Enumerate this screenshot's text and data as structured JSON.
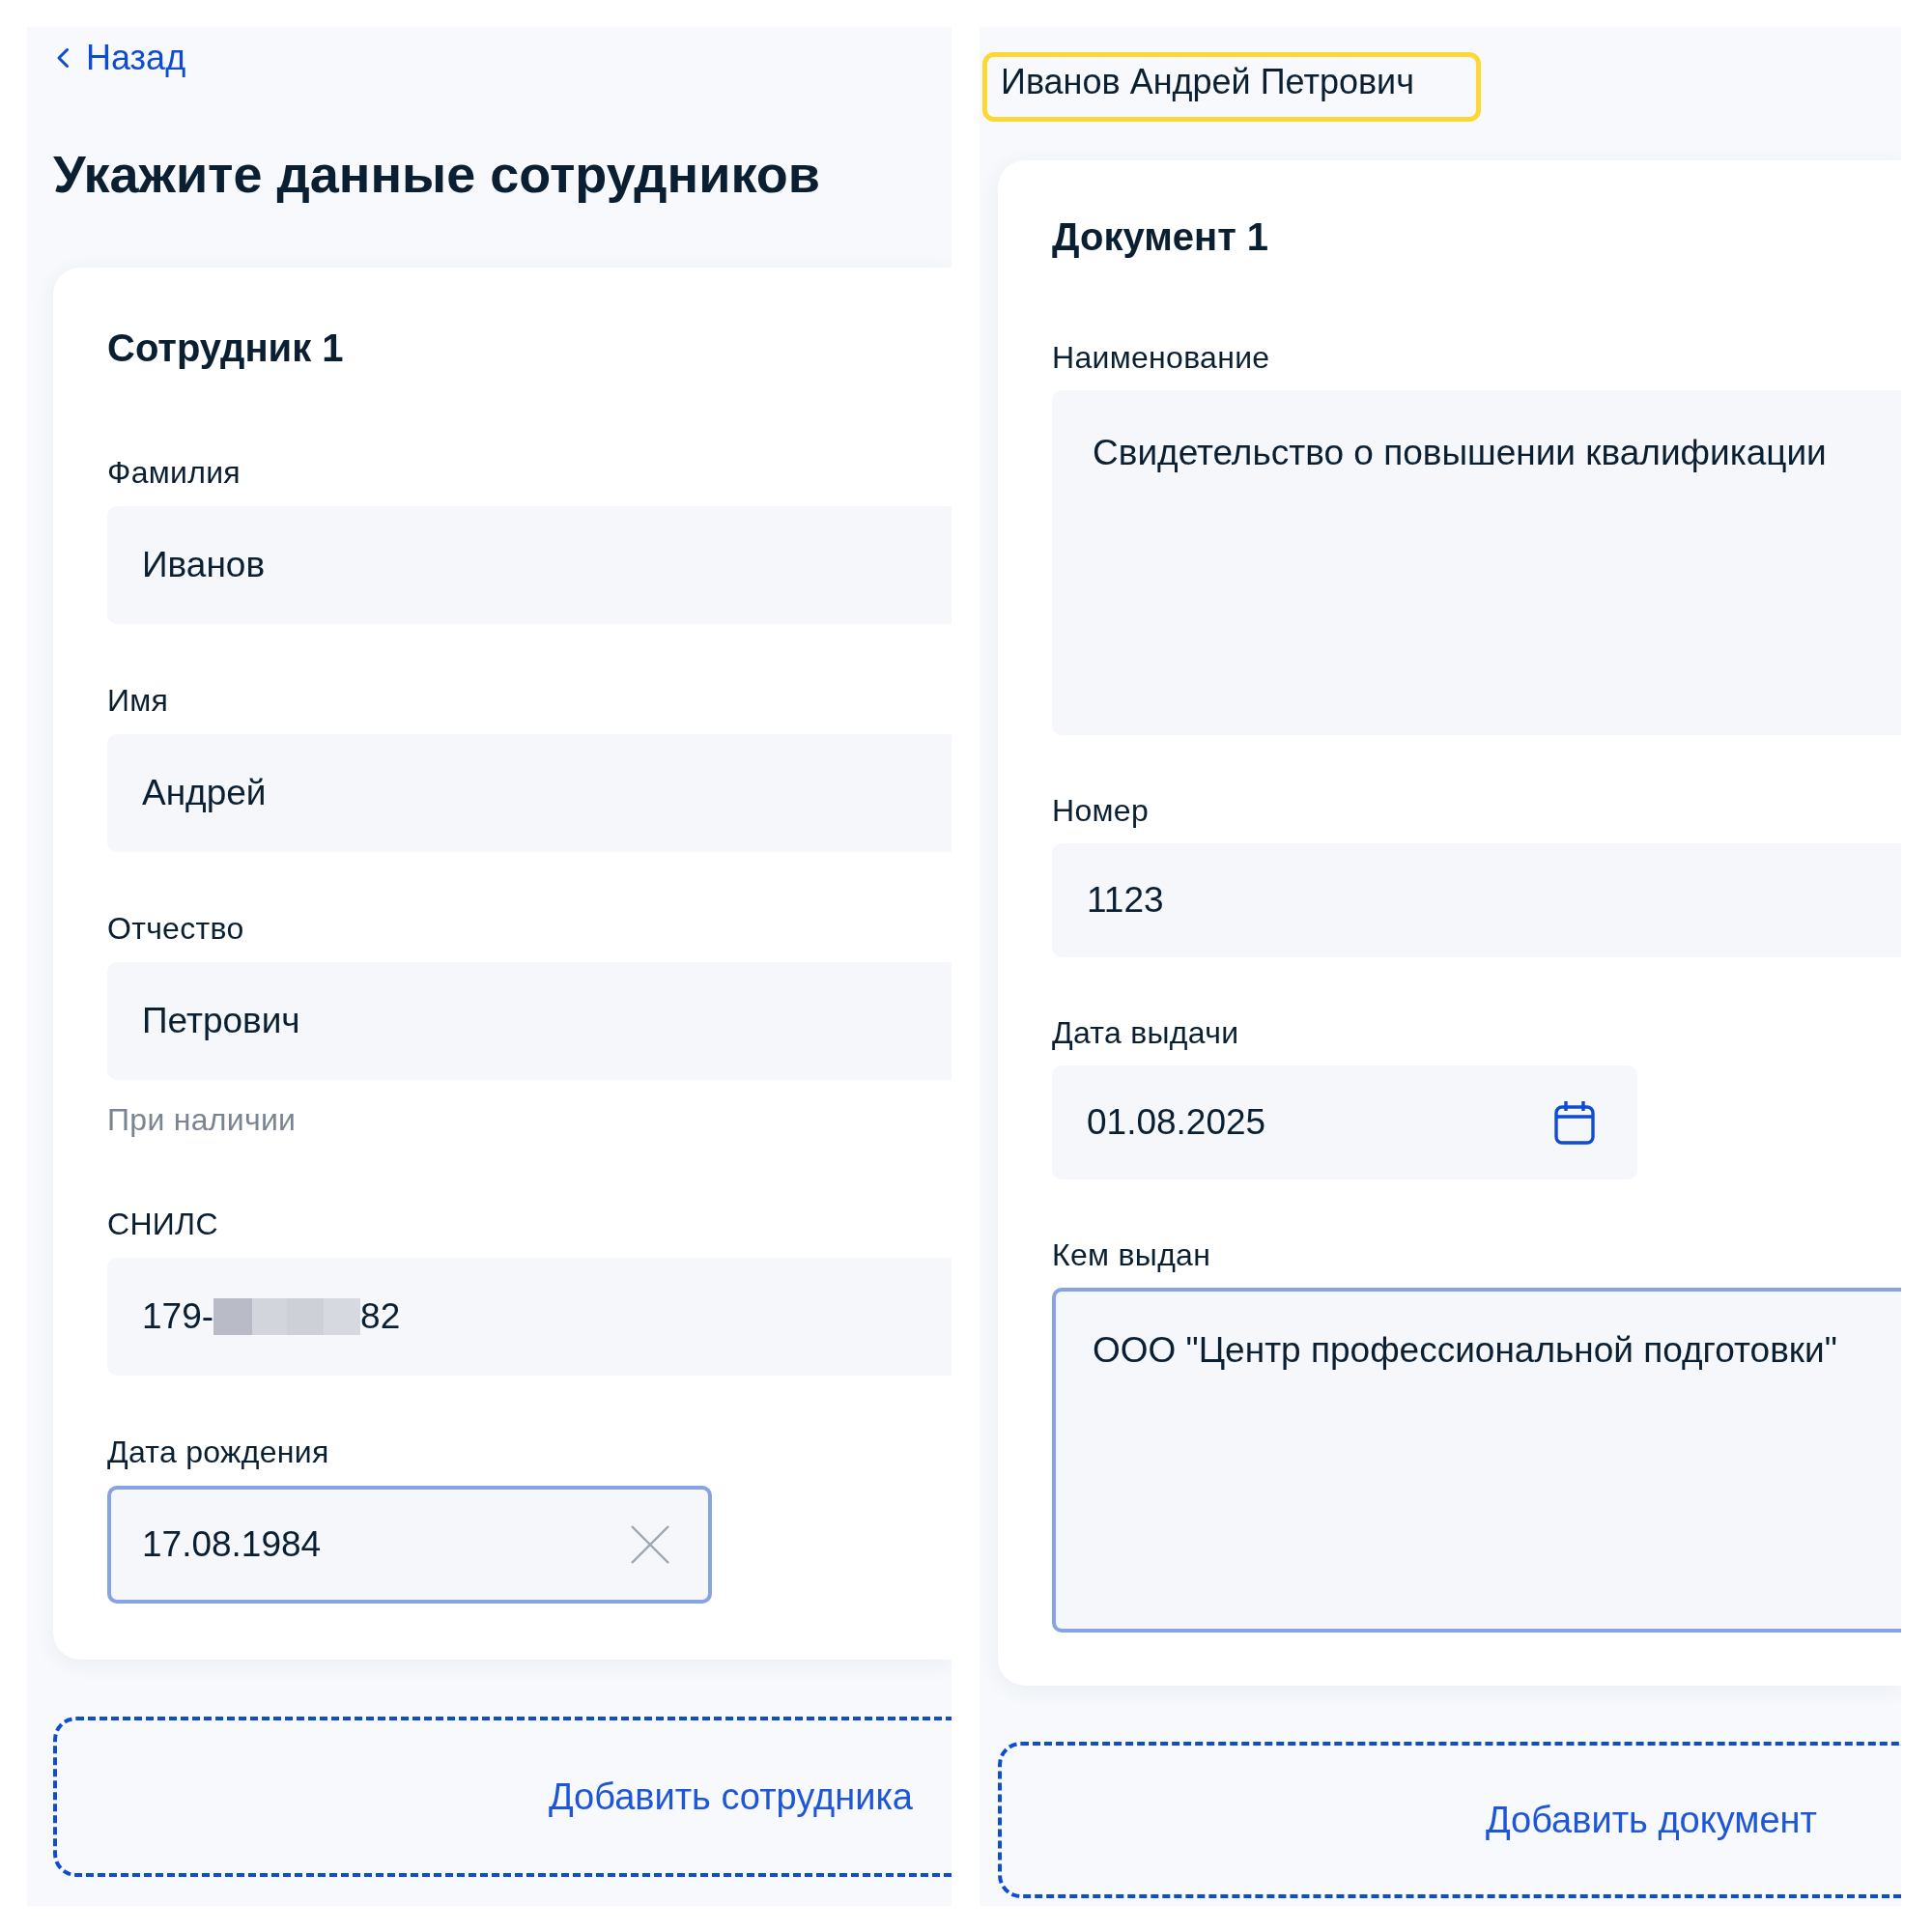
{
  "employee_panel": {
    "back_link": {
      "label": "Назад"
    },
    "title": "Укажите данные сотрудников",
    "card": {
      "title": "Сотрудник 1",
      "fields": [
        {
          "kind": "input",
          "label": "Фамилия",
          "value": "Иванов",
          "focused": false
        },
        {
          "kind": "input",
          "label": "Имя",
          "value": "Андрей",
          "focused": false
        },
        {
          "kind": "input",
          "label": "Отчество",
          "value": "Петрович",
          "focused": false,
          "hint": "При наличии"
        },
        {
          "kind": "input",
          "label": "СНИЛС",
          "value": "179-",
          "value_end": "82",
          "redacted": true,
          "focused": false
        },
        {
          "kind": "cleardate",
          "label": "Дата рождения",
          "value": "17.08.1984",
          "focused": true
        }
      ]
    },
    "add_button": {
      "label": "Добавить сотрудника"
    }
  },
  "document_panel": {
    "employee_name": {
      "text": "Иванов Андрей Петрович",
      "highlighted": true
    },
    "card": {
      "title": "Документ 1",
      "fields": [
        {
          "kind": "textarea",
          "label": "Наименование",
          "value": "Свидетельство о повышении квалификации",
          "focused": false
        },
        {
          "kind": "input",
          "label": "Номер",
          "value": "1123",
          "focused": false
        },
        {
          "kind": "datepicker",
          "label": "Дата выдачи",
          "value": "01.08.2025",
          "focused": false
        },
        {
          "kind": "textarea",
          "label": "Кем выдан",
          "value": "ООО \"Центр профессиональной подготовки\"",
          "focused": true
        }
      ]
    },
    "add_button": {
      "label": "Добавить документ"
    }
  }
}
